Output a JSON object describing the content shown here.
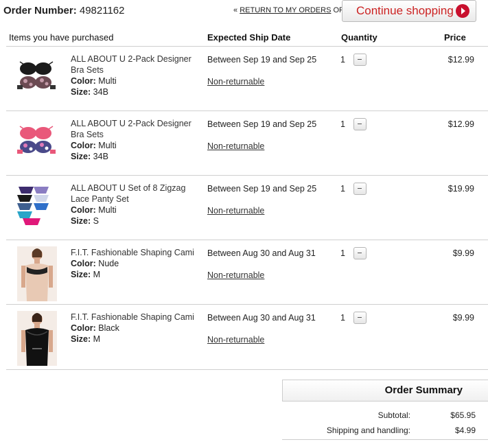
{
  "header": {
    "order_label": "Order Number:",
    "order_number": "49821162",
    "return_prefix": "«",
    "return_link": "RETURN TO MY ORDERS",
    "or_text": "OR",
    "continue_label": "Continue shopping"
  },
  "columns": {
    "items": "Items you have purchased",
    "ship": "Expected Ship Date",
    "quantity": "Quantity",
    "price": "Price"
  },
  "items": [
    {
      "name": "ALL ABOUT U 2-Pack Designer Bra Sets",
      "color_label": "Color:",
      "color": "Multi",
      "size_label": "Size:",
      "size": "34B",
      "ship": "Between Sep 19 and Sep 25",
      "returnable": "Non-returnable",
      "qty": "1",
      "price": "$12.99",
      "thumb": "bra-black-icon"
    },
    {
      "name": "ALL ABOUT U 2-Pack Designer Bra Sets",
      "color_label": "Color:",
      "color": "Multi",
      "size_label": "Size:",
      "size": "34B",
      "ship": "Between Sep 19 and Sep 25",
      "returnable": "Non-returnable",
      "qty": "1",
      "price": "$12.99",
      "thumb": "bra-pink-icon"
    },
    {
      "name": "ALL ABOUT U Set of 8 Zigzag Lace Panty Set",
      "color_label": "Color:",
      "color": "Multi",
      "size_label": "Size:",
      "size": "S",
      "ship": "Between Sep 19 and Sep 25",
      "returnable": "Non-returnable",
      "qty": "1",
      "price": "$19.99",
      "thumb": "panty-set-icon"
    },
    {
      "name": "F.I.T. Fashionable Shaping Cami",
      "color_label": "Color:",
      "color": "Nude",
      "size_label": "Size:",
      "size": "M",
      "ship": "Between Aug 30 and Aug 31",
      "returnable": "Non-returnable",
      "qty": "1",
      "price": "$9.99",
      "thumb": "cami-nude-icon"
    },
    {
      "name": "F.I.T. Fashionable Shaping Cami",
      "color_label": "Color:",
      "color": "Black",
      "size_label": "Size:",
      "size": "M",
      "ship": "Between Aug 30 and Aug 31",
      "returnable": "Non-returnable",
      "qty": "1",
      "price": "$9.99",
      "thumb": "cami-black-icon"
    }
  ],
  "summary": {
    "title": "Order Summary",
    "subtotal_label": "Subtotal:",
    "subtotal": "$65.95",
    "shipping_label": "Shipping and handling:",
    "shipping": "$4.99"
  },
  "colors": {
    "accent": "#c8102e",
    "separator": "#cfcfcf"
  }
}
